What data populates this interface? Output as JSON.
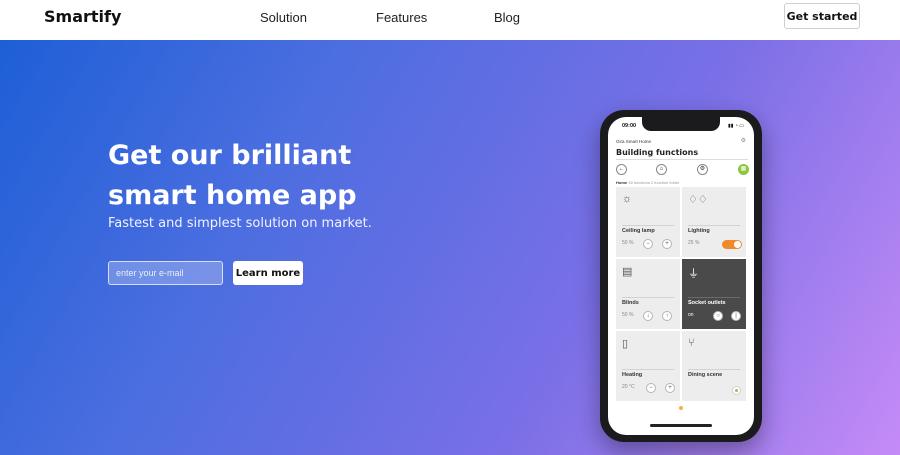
{
  "header": {
    "logo": "Smartify",
    "nav": [
      "Solution",
      "Features",
      "Blog"
    ],
    "cta": "Get started"
  },
  "hero": {
    "title": "Get our brilliant smart home app",
    "subtitle": "Fastest and simplest solution on market.",
    "email_placeholder": "enter your e-mail",
    "button": "Learn more",
    "gradient": [
      "#1e5fd6",
      "#c58bf7"
    ]
  },
  "phone": {
    "time": "09:00",
    "app_name": "Gira Smart Home",
    "screen_title": "Building functions",
    "breadcrumb_home": "Home",
    "breadcrumb_rest": "16 functions 2 function folder",
    "tiles": [
      {
        "name": "Ceiling lamp",
        "value": "50 %",
        "icon": "lamp-icon"
      },
      {
        "name": "Lighting",
        "value": "25 %",
        "icon": "lighting-icon"
      },
      {
        "name": "Blinds",
        "value": "50 %",
        "icon": "blinds-icon"
      },
      {
        "name": "Socket outlets",
        "value": "on",
        "icon": "socket-icon"
      },
      {
        "name": "Heating",
        "value": "20 °C",
        "icon": "thermometer-icon"
      },
      {
        "name": "Dining scene",
        "value": "",
        "icon": "fork-knife-icon"
      }
    ],
    "accent": "#8dc63f",
    "toggle_color": "#f08a2c"
  }
}
